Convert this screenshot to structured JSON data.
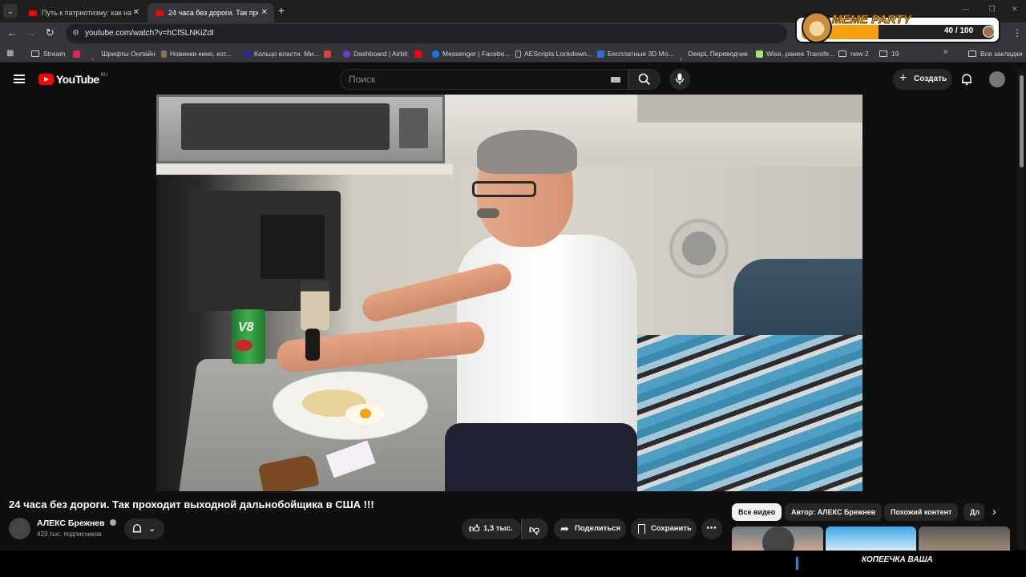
{
  "browser": {
    "tabs": [
      {
        "title": "Путь к патриотизму: как научи",
        "active": false
      },
      {
        "title": "24 часа без дороги. Так прохо",
        "active": true
      }
    ],
    "url": "youtube.com/watch?v=hCfSLNKiZdI",
    "bookmarks": [
      {
        "label": "Stream",
        "icon": "folder-icon"
      },
      {
        "label": "Шрифты Онлайн",
        "icon": "bookmark-icon"
      },
      {
        "label": "Новинки кино, кот...",
        "icon": "bookmark-icon"
      },
      {
        "label": "Кольцо власти. Ми...",
        "icon": "bookmark-icon"
      },
      {
        "label": "Dashboard | Airbit",
        "icon": "bookmark-icon"
      },
      {
        "label": "Messenger | Facebo...",
        "icon": "facebook-icon"
      },
      {
        "label": "AEScripts Lockdown...",
        "icon": "bookmark-icon"
      },
      {
        "label": "Бесплатные 3D Мо...",
        "icon": "bookmark-icon"
      },
      {
        "label": "DeepL Переводчик",
        "icon": "bookmark-icon"
      },
      {
        "label": "Wise, ранее Transfe...",
        "icon": "bookmark-icon"
      },
      {
        "label": "new 2",
        "icon": "folder-icon"
      },
      {
        "label": "19",
        "icon": "folder-icon"
      }
    ],
    "all_bookmarks": "Все закладки"
  },
  "extension": {
    "name": "MEME PARTY",
    "counter": "40 / 100",
    "progress": 0.4
  },
  "youtube": {
    "logo_text": "YouTube",
    "region": "RU",
    "search_placeholder": "Поиск",
    "create_label": "Создать"
  },
  "video": {
    "title": "24 часа без дороги. Так проходит выходной дальнобойщика в США !!!",
    "channel": "АЛЕКС Брежнев",
    "subscribers": "423 тыс. подписчиков",
    "likes": "1,3 тыс.",
    "share_label": "Поделиться",
    "save_label": "Сохранить",
    "can_label": "V8"
  },
  "chips": [
    "Все видео",
    "Автор: АЛЕКС Брежнев",
    "Похожий контент",
    "Дл"
  ],
  "overlay_text": "КОПЕЕЧКА ВАША",
  "colors": {
    "accent": "#ff0000",
    "meme_orange": "#f5a011",
    "background": "#0f0f0f"
  }
}
